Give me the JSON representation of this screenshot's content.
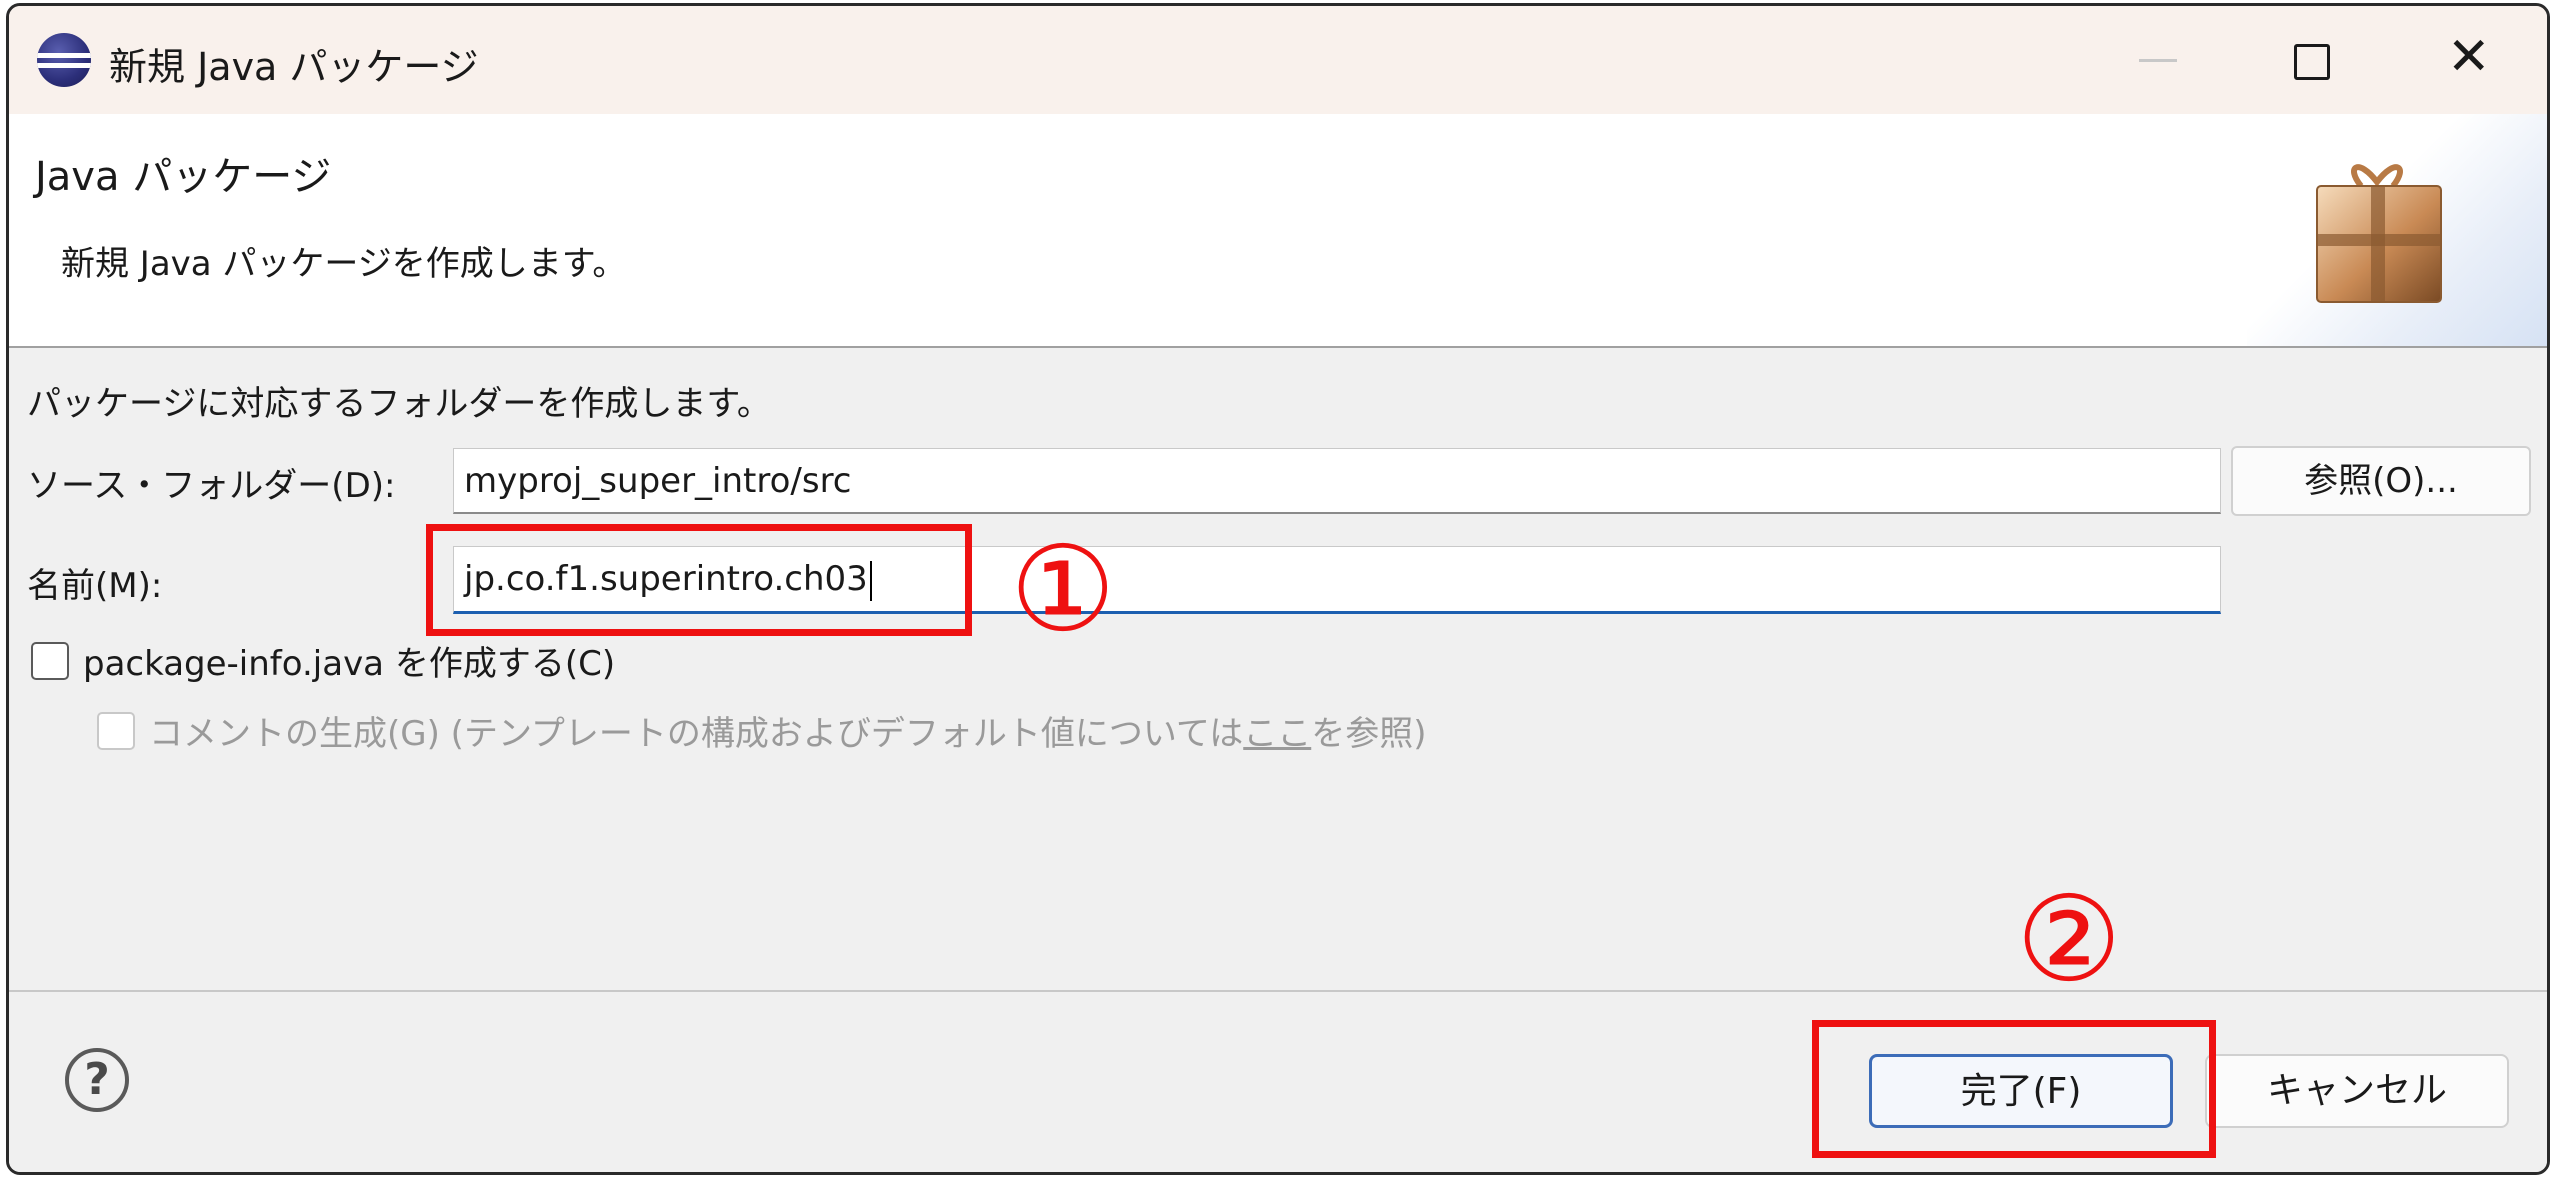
{
  "window": {
    "title": "新規 Java パッケージ",
    "min_icon": "minimize-icon",
    "max_icon": "maximize-icon",
    "close_label": "✕"
  },
  "header": {
    "title": "Java パッケージ",
    "description": "新規 Java パッケージを作成します。",
    "wizard_icon": "package-gift-icon"
  },
  "form": {
    "intro": "パッケージに対応するフォルダーを作成します。",
    "source_folder_label": "ソース・フォルダー(D):",
    "source_folder_value": "myproj_super_intro/src",
    "browse_label": "参照(O)...",
    "name_label": "名前(M):",
    "name_value": "jp.co.f1.superintro.ch03",
    "create_package_info_label": "package-info.java を作成する(C)",
    "create_package_info_checked": false,
    "generate_comments_label_prefix": "コメントの生成(G) (テンプレートの構成およびデフォルト値については",
    "generate_comments_link": "ここ",
    "generate_comments_label_suffix": "を参照)",
    "generate_comments_checked": false
  },
  "footer": {
    "help_label": "?",
    "finish_label": "完了(F)",
    "cancel_label": "キャンセル"
  },
  "annotations": {
    "step1": "①",
    "step2": "②",
    "color": "#ee1111"
  }
}
